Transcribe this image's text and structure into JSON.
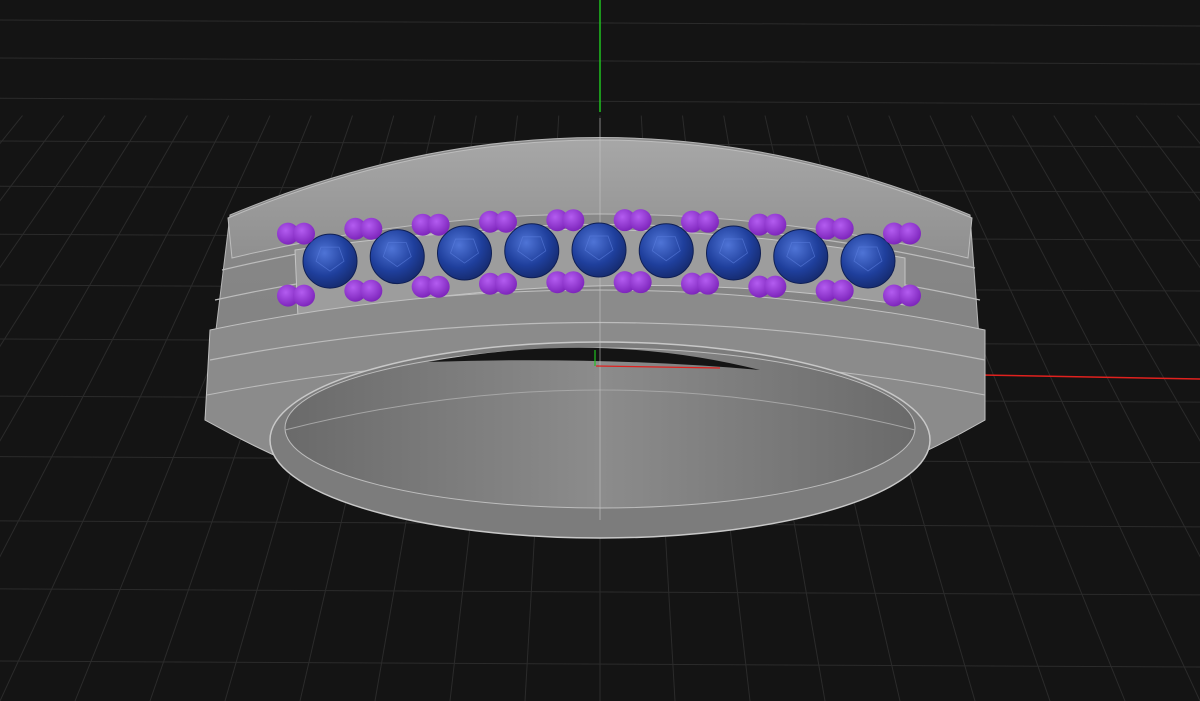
{
  "viewport": {
    "background_color": "#141414",
    "grid_color": "#2b2b2b",
    "axis_x_color": "#e0211e",
    "axis_y_color": "#1fc21f"
  },
  "model": {
    "metal_color": "#9a9a9a",
    "metal_shadow_color": "#6e6e6e",
    "gem_color": "#1f3f9c",
    "gem_highlight_color": "#3e63c9",
    "prong_color": "#8a2bd0",
    "gem_count": 9
  }
}
